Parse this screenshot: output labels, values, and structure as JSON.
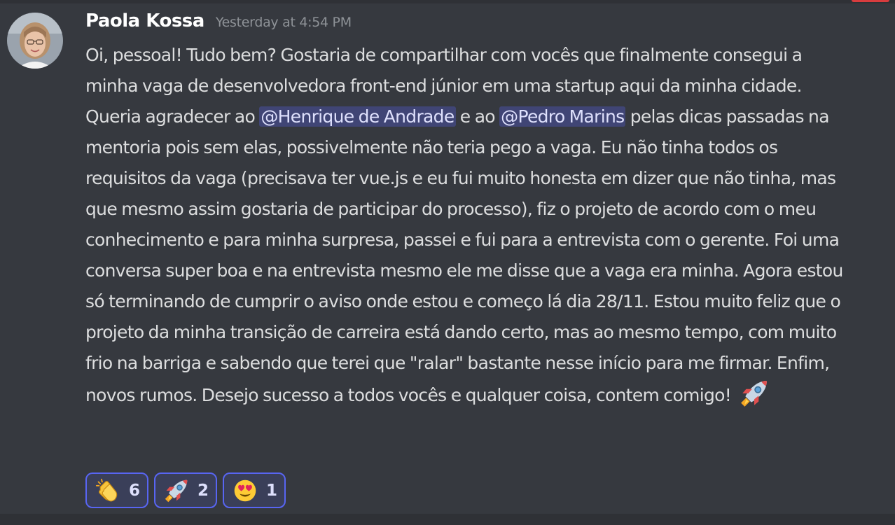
{
  "message": {
    "author": "Paola Kossa",
    "timestamp": "Yesterday at 4:54 PM",
    "avatar_icon": "user-avatar-photo",
    "text_parts": {
      "p1": "Oi, pessoal! Tudo bem? Gostaria de compartilhar com vocês que finalmente consegui a minha vaga de desenvolvedora front-end júnior em uma startup aqui da minha cidade.  Queria agradecer ao ",
      "mention1": "@Henrique de Andrade",
      "p2": "  e ao ",
      "mention2": "@Pedro Marins",
      "p3": " pelas dicas passadas na mentoria pois sem elas, possivelmente não teria pego a vaga. Eu não tinha todos os requisitos da vaga (precisava ter vue.js e eu fui muito honesta em dizer que não tinha, mas que mesmo assim gostaria de participar do processo), fiz o projeto de acordo com o meu conhecimento e para minha surpresa, passei e fui para a entrevista com o gerente. Foi uma conversa super boa e na entrevista mesmo ele me disse que a vaga era minha. Agora estou só terminando de cumprir o aviso onde estou e começo lá dia 28/11. Estou muito feliz que o projeto da minha transição de carreira está dando certo, mas ao mesmo tempo, com muito frio na barriga e sabendo que terei que \"ralar\" bastante nesse início para me firmar. Enfim, novos rumos. Desejo sucesso a todos vocês e qualquer coisa, contem comigo! "
    },
    "inline_emoji": "rocket-emoji"
  },
  "reactions": [
    {
      "emoji": "clapping-hands-emoji",
      "count": "6"
    },
    {
      "emoji": "rocket-emoji",
      "count": "2"
    },
    {
      "emoji": "heart-eyes-emoji",
      "count": "1"
    }
  ],
  "colors": {
    "background": "#36393f",
    "username": "#ffffff",
    "timestamp": "#8e9297",
    "text": "#dcddde",
    "mention_bg": "rgba(88,101,242,0.3)",
    "mention_text": "#dee0fc",
    "reaction_border": "#5865f2"
  }
}
